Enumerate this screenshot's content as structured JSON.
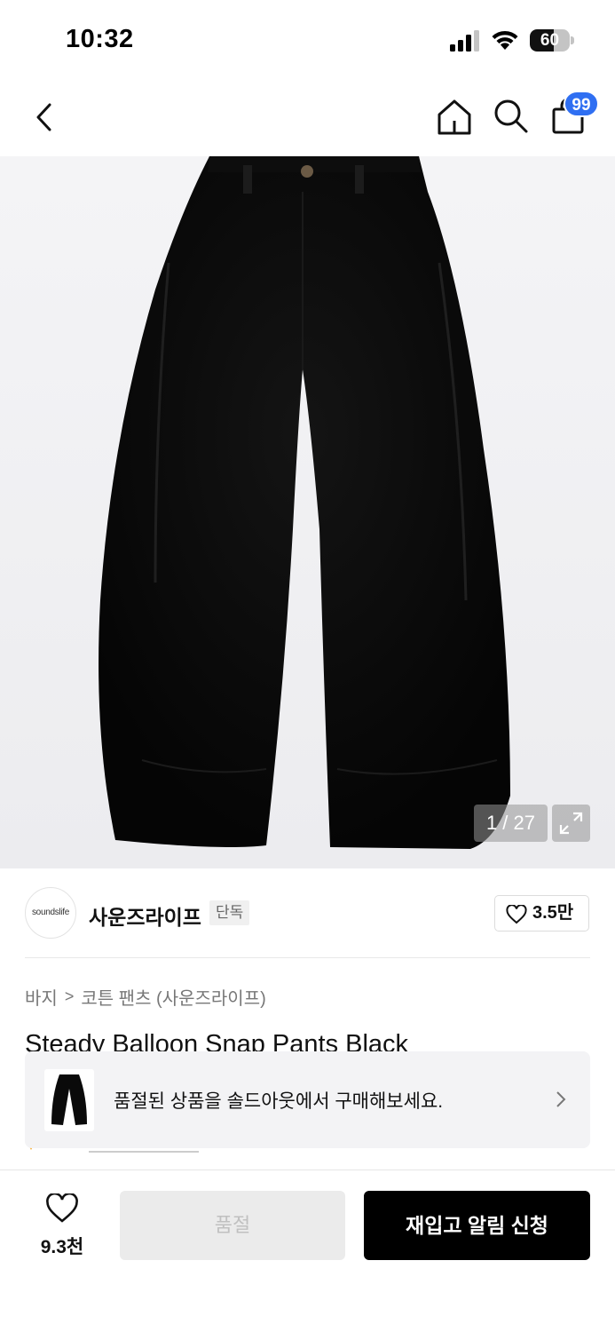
{
  "status_bar": {
    "time": "10:32",
    "battery": "60",
    "battery_level_percent": 60
  },
  "nav": {
    "cart_badge": "99",
    "icons": [
      "back-icon",
      "home-icon",
      "search-icon",
      "shopping-bag-icon"
    ]
  },
  "gallery": {
    "counter": "1 / 27",
    "icons": [
      "expand-icon"
    ]
  },
  "brand": {
    "logo_text": "soundslife",
    "name": "사운즈라이프",
    "tag": "단독",
    "like_count": "3.5만"
  },
  "breadcrumb": {
    "category": "바지",
    "separator": ">",
    "subcategory": "코튼 팬츠 (사운즈라이프)"
  },
  "product": {
    "title": "Steady Balloon Snap Pants Black"
  },
  "soldout_banner": {
    "text": "품절된 상품을 솔드아웃에서 구매해보세요."
  },
  "bottom_bar": {
    "wish_count": "9.3천",
    "soldout_label": "품절",
    "restock_label": "재입고 알림 신청"
  },
  "colors": {
    "accent_badge": "#2f6ff2",
    "primary_button": "#000000",
    "disabled_button": "#ebebeb"
  }
}
